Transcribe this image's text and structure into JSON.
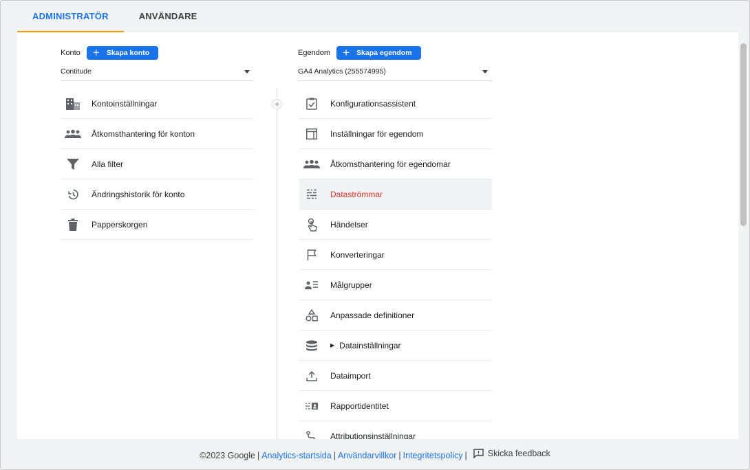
{
  "tabs": [
    {
      "label": "ADMINISTRATÖR",
      "active": true
    },
    {
      "label": "ANVÄNDARE",
      "active": false
    }
  ],
  "account": {
    "label": "Konto",
    "create_label": "Skapa konto",
    "selected": "Contitude",
    "items": [
      {
        "label": "Kontoinställningar",
        "icon": "building-icon"
      },
      {
        "label": "Åtkomsthantering för konton",
        "icon": "people-icon"
      },
      {
        "label": "Alla filter",
        "icon": "filter-icon"
      },
      {
        "label": "Ändringshistorik för konto",
        "icon": "history-icon"
      },
      {
        "label": "Papperskorgen",
        "icon": "trash-icon"
      }
    ]
  },
  "property": {
    "label": "Egendom",
    "create_label": "Skapa egendom",
    "selected": "GA4 Analytics (255574995)",
    "items": [
      {
        "label": "Konfigurationsassistent",
        "icon": "checklist-icon"
      },
      {
        "label": "Inställningar för egendom",
        "icon": "property-icon"
      },
      {
        "label": "Åtkomsthantering för egendomar",
        "icon": "people-icon"
      },
      {
        "label": "Dataströmmar",
        "icon": "streams-icon",
        "selected": true
      },
      {
        "label": "Händelser",
        "icon": "touch-icon"
      },
      {
        "label": "Konverteringar",
        "icon": "flag-icon"
      },
      {
        "label": "Målgrupper",
        "icon": "audience-icon"
      },
      {
        "label": "Anpassade definitioner",
        "icon": "shapes-icon"
      },
      {
        "label": "Datainställningar",
        "icon": "database-icon",
        "expandable": true
      },
      {
        "label": "Dataimport",
        "icon": "upload-icon"
      },
      {
        "label": "Rapportidentitet",
        "icon": "identity-icon"
      },
      {
        "label": "Attributionsinställningar",
        "icon": "route-icon"
      }
    ]
  },
  "footer": {
    "copyright": "©2023 Google",
    "links": [
      "Analytics-startsida",
      "Användarvillkor",
      "Integritetspolicy"
    ],
    "feedback": "Skicka feedback"
  },
  "colors": {
    "accent": "#1a73e8",
    "selected_text": "#d93025",
    "tab_indicator": "#f29900"
  }
}
